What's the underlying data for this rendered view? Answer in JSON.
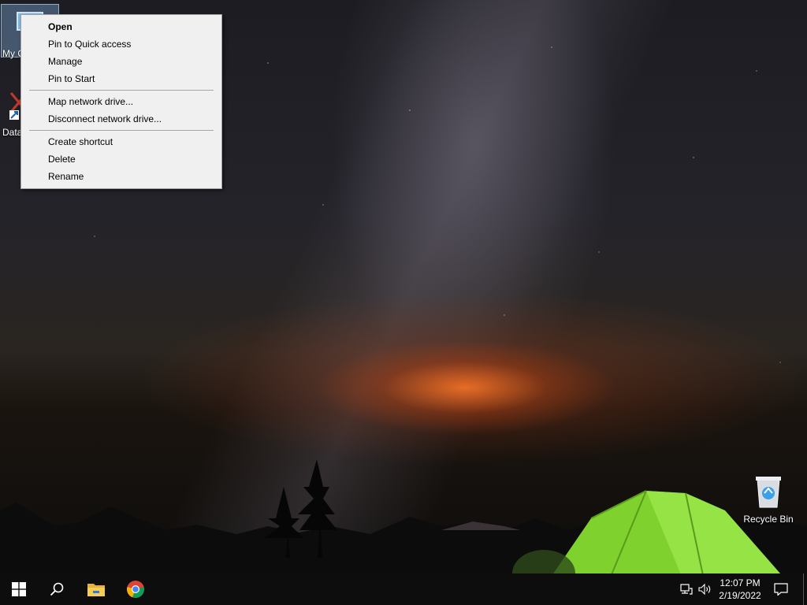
{
  "desktop": {
    "icons": [
      {
        "label": "My Computer"
      },
      {
        "label": "Data"
      },
      {
        "label": "Recycle Bin"
      }
    ]
  },
  "context_menu": {
    "groups": [
      [
        {
          "label": "Open",
          "bold": true
        },
        {
          "label": "Pin to Quick access"
        },
        {
          "label": "Manage"
        },
        {
          "label": "Pin to Start"
        }
      ],
      [
        {
          "label": "Map network drive..."
        },
        {
          "label": "Disconnect network drive..."
        }
      ],
      [
        {
          "label": "Create shortcut"
        },
        {
          "label": "Delete"
        },
        {
          "label": "Rename"
        }
      ]
    ]
  },
  "taskbar": {
    "icons": [
      "windows-start-icon",
      "search-icon",
      "file-explorer-icon",
      "chrome-icon"
    ],
    "tray": {
      "time": "12:07 PM",
      "date": "2/19/2022"
    }
  },
  "colors": {
    "menu_bg": "#f0f0f0",
    "taskbar_bg": "#0e0d0e",
    "accent_tent": "#8ee03a"
  }
}
